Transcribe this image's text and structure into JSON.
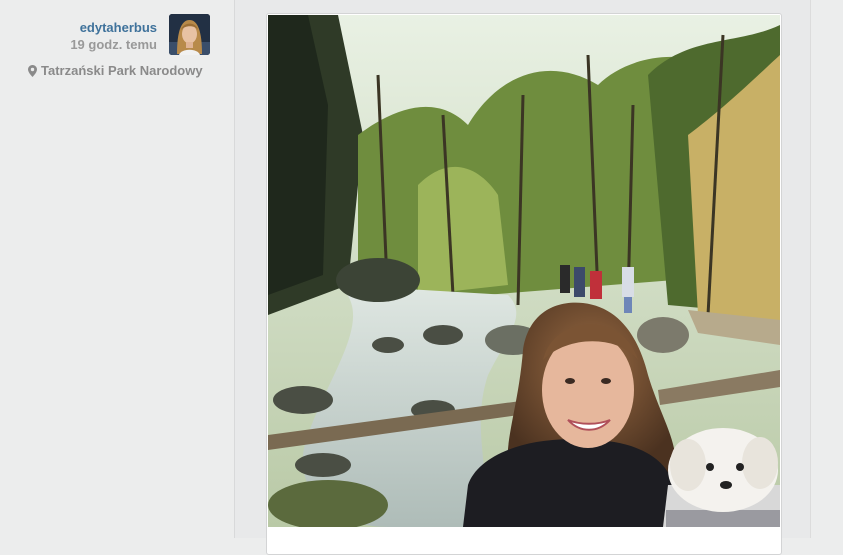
{
  "post": {
    "username": "edytaherbus",
    "time_ago": "19 godz. temu",
    "location": "Tatrzański Park Narodowy"
  },
  "icons": {
    "location": "map-pin-icon",
    "avatar": "user-avatar"
  },
  "colors": {
    "username": "#3f729b",
    "meta_text": "#999999",
    "page_bg": "#eceded"
  }
}
